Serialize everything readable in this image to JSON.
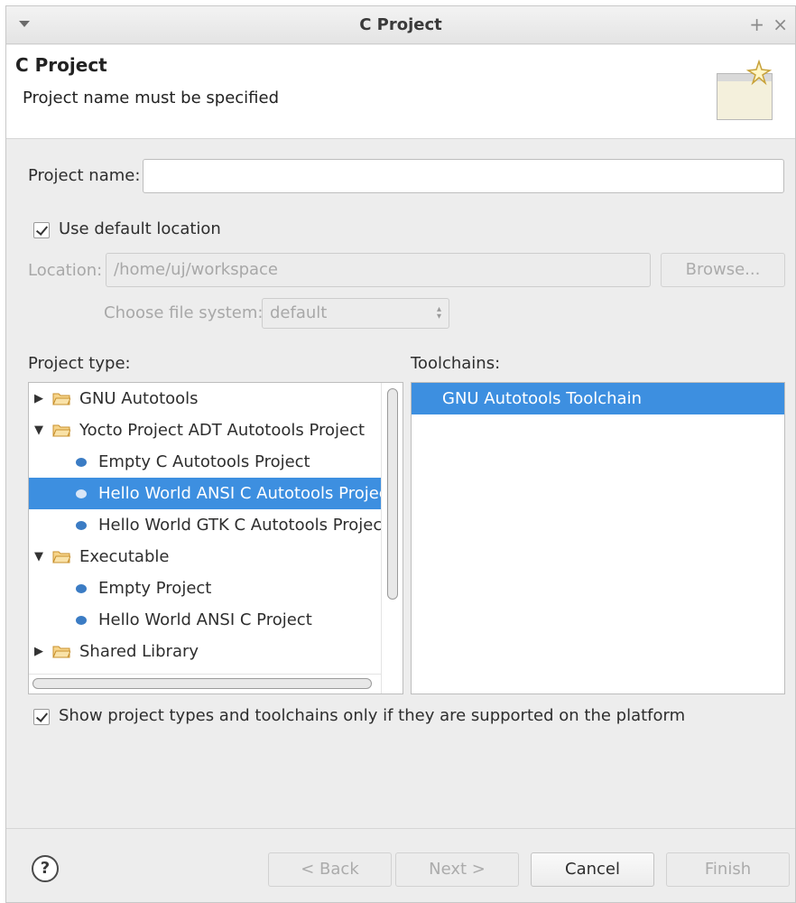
{
  "window": {
    "title": "C Project"
  },
  "header": {
    "title": "C Project",
    "message": "Project name must be specified",
    "icon": "new-project-wizard-icon"
  },
  "form": {
    "project_name_label": "Project name:",
    "project_name_value": "",
    "use_default_location_label": "Use default location",
    "use_default_location_checked": true,
    "location_label": "Location:",
    "location_value": "/home/uj/workspace",
    "browse_label": "Browse...",
    "file_system_label": "Choose file system:",
    "file_system_value": "default"
  },
  "project_types": {
    "label": "Project type:",
    "items": [
      {
        "label": "GNU Autotools",
        "kind": "folder",
        "expanded": false,
        "selected": false
      },
      {
        "label": "Yocto Project ADT Autotools Project",
        "kind": "folder",
        "expanded": true,
        "selected": false
      },
      {
        "label": "Empty C Autotools Project",
        "kind": "leaf",
        "selected": false
      },
      {
        "label": "Hello World ANSI C Autotools Project",
        "kind": "leaf",
        "selected": true
      },
      {
        "label": "Hello World GTK C Autotools Project",
        "kind": "leaf",
        "selected": false
      },
      {
        "label": "Executable",
        "kind": "folder",
        "expanded": true,
        "selected": false
      },
      {
        "label": "Empty Project",
        "kind": "leaf",
        "selected": false
      },
      {
        "label": "Hello World ANSI C Project",
        "kind": "leaf",
        "selected": false
      },
      {
        "label": "Shared Library",
        "kind": "folder",
        "expanded": false,
        "selected": false
      }
    ]
  },
  "toolchains": {
    "label": "Toolchains:",
    "items": [
      {
        "label": "GNU Autotools Toolchain",
        "selected": true
      }
    ]
  },
  "filter": {
    "label": "Show project types and toolchains only if they are supported on the platform",
    "checked": true
  },
  "buttons": {
    "back": "< Back",
    "next": "Next >",
    "cancel": "Cancel",
    "finish": "Finish"
  },
  "colors": {
    "selection": "#3d8fe0",
    "bullet": "#3b7cc4",
    "folder": "#e8b04a"
  }
}
